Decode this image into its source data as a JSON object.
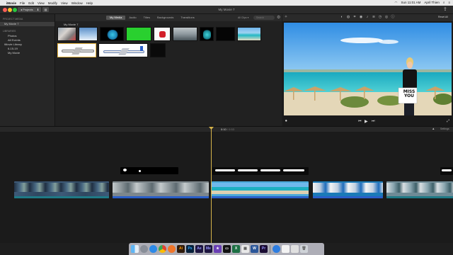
{
  "menubar": {
    "app": "iMovie",
    "items": [
      "File",
      "Edit",
      "View",
      "Modify",
      "View",
      "Window",
      "Help"
    ],
    "time": "Sun 11:01 AM",
    "user": "April Thien"
  },
  "toolbar": {
    "projects_label": "◂ Projects",
    "window_title": "My Movie 7"
  },
  "sidebar": {
    "project_media_header": "PROJECT MEDIA",
    "project_item": "My Movie 7",
    "libraries_header": "LIBRARIES",
    "photos": "Photos",
    "all_events": "All Events",
    "imovie_library": "iMovie Library",
    "date_event": "6-15-19",
    "my_movie": "My Movie"
  },
  "browser": {
    "tabs": [
      "My Media",
      "Audio",
      "Titles",
      "Backgrounds",
      "Transitions"
    ],
    "active_tab": "My Media",
    "project_title": "My Movie 7",
    "filter": "All Clips ▾",
    "search_placeholder": "Search"
  },
  "viewer": {
    "reset_label": "Reset All",
    "sign_text_1": "MISS",
    "sign_text_2": "YOU"
  },
  "timeline": {
    "current_time": "0:10",
    "total_time": "/ 0:53",
    "settings_label": "Settings"
  },
  "colors": {
    "selection": "#e9b640",
    "audio_bar": "#2a5fc8",
    "playhead": "#d6b34a"
  },
  "dock": {
    "icons": [
      "finder-icon",
      "launchpad-icon",
      "safari-icon",
      "chrome-icon",
      "firefox-icon",
      "illustrator-icon",
      "photoshop-icon",
      "after-effects-icon",
      "media-encoder-icon",
      "imovie-icon",
      "terminal-icon",
      "excel-icon",
      "preview-icon",
      "word-icon",
      "premiere-icon",
      "folder-icon",
      "files-icon",
      "documents-icon",
      "trash-icon"
    ],
    "labels": {
      "ai": "Ai",
      "ps": "Ps",
      "ae": "Ae",
      "me": "Me",
      "pr": "Pr",
      "x": "X",
      "w": "W"
    }
  }
}
